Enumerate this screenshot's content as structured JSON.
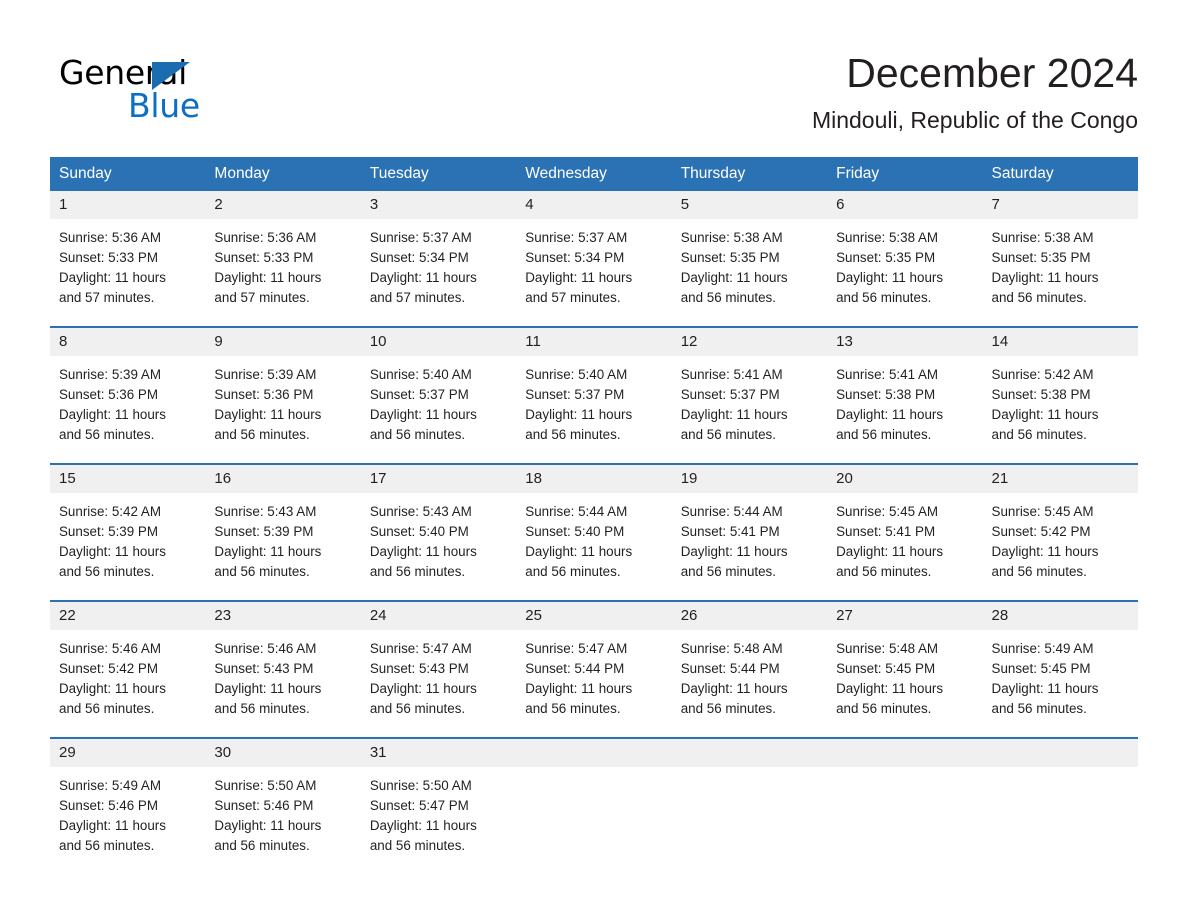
{
  "brand": {
    "name_part1": "General",
    "name_part2": "Blue",
    "accent_color": "#1b6cb0",
    "blue_text_color": "#0b6fc4"
  },
  "header": {
    "month_title": "December 2024",
    "location": "Mindouli, Republic of the Congo"
  },
  "calendar": {
    "header_bg": "#2b72b4",
    "day_number_bg": "#f0f0f0",
    "weekdays": [
      "Sunday",
      "Monday",
      "Tuesday",
      "Wednesday",
      "Thursday",
      "Friday",
      "Saturday"
    ],
    "weeks": [
      [
        {
          "day": "1",
          "sunrise": "Sunrise: 5:36 AM",
          "sunset": "Sunset: 5:33 PM",
          "daylight_line1": "Daylight: 11 hours",
          "daylight_line2": "and 57 minutes."
        },
        {
          "day": "2",
          "sunrise": "Sunrise: 5:36 AM",
          "sunset": "Sunset: 5:33 PM",
          "daylight_line1": "Daylight: 11 hours",
          "daylight_line2": "and 57 minutes."
        },
        {
          "day": "3",
          "sunrise": "Sunrise: 5:37 AM",
          "sunset": "Sunset: 5:34 PM",
          "daylight_line1": "Daylight: 11 hours",
          "daylight_line2": "and 57 minutes."
        },
        {
          "day": "4",
          "sunrise": "Sunrise: 5:37 AM",
          "sunset": "Sunset: 5:34 PM",
          "daylight_line1": "Daylight: 11 hours",
          "daylight_line2": "and 57 minutes."
        },
        {
          "day": "5",
          "sunrise": "Sunrise: 5:38 AM",
          "sunset": "Sunset: 5:35 PM",
          "daylight_line1": "Daylight: 11 hours",
          "daylight_line2": "and 56 minutes."
        },
        {
          "day": "6",
          "sunrise": "Sunrise: 5:38 AM",
          "sunset": "Sunset: 5:35 PM",
          "daylight_line1": "Daylight: 11 hours",
          "daylight_line2": "and 56 minutes."
        },
        {
          "day": "7",
          "sunrise": "Sunrise: 5:38 AM",
          "sunset": "Sunset: 5:35 PM",
          "daylight_line1": "Daylight: 11 hours",
          "daylight_line2": "and 56 minutes."
        }
      ],
      [
        {
          "day": "8",
          "sunrise": "Sunrise: 5:39 AM",
          "sunset": "Sunset: 5:36 PM",
          "daylight_line1": "Daylight: 11 hours",
          "daylight_line2": "and 56 minutes."
        },
        {
          "day": "9",
          "sunrise": "Sunrise: 5:39 AM",
          "sunset": "Sunset: 5:36 PM",
          "daylight_line1": "Daylight: 11 hours",
          "daylight_line2": "and 56 minutes."
        },
        {
          "day": "10",
          "sunrise": "Sunrise: 5:40 AM",
          "sunset": "Sunset: 5:37 PM",
          "daylight_line1": "Daylight: 11 hours",
          "daylight_line2": "and 56 minutes."
        },
        {
          "day": "11",
          "sunrise": "Sunrise: 5:40 AM",
          "sunset": "Sunset: 5:37 PM",
          "daylight_line1": "Daylight: 11 hours",
          "daylight_line2": "and 56 minutes."
        },
        {
          "day": "12",
          "sunrise": "Sunrise: 5:41 AM",
          "sunset": "Sunset: 5:37 PM",
          "daylight_line1": "Daylight: 11 hours",
          "daylight_line2": "and 56 minutes."
        },
        {
          "day": "13",
          "sunrise": "Sunrise: 5:41 AM",
          "sunset": "Sunset: 5:38 PM",
          "daylight_line1": "Daylight: 11 hours",
          "daylight_line2": "and 56 minutes."
        },
        {
          "day": "14",
          "sunrise": "Sunrise: 5:42 AM",
          "sunset": "Sunset: 5:38 PM",
          "daylight_line1": "Daylight: 11 hours",
          "daylight_line2": "and 56 minutes."
        }
      ],
      [
        {
          "day": "15",
          "sunrise": "Sunrise: 5:42 AM",
          "sunset": "Sunset: 5:39 PM",
          "daylight_line1": "Daylight: 11 hours",
          "daylight_line2": "and 56 minutes."
        },
        {
          "day": "16",
          "sunrise": "Sunrise: 5:43 AM",
          "sunset": "Sunset: 5:39 PM",
          "daylight_line1": "Daylight: 11 hours",
          "daylight_line2": "and 56 minutes."
        },
        {
          "day": "17",
          "sunrise": "Sunrise: 5:43 AM",
          "sunset": "Sunset: 5:40 PM",
          "daylight_line1": "Daylight: 11 hours",
          "daylight_line2": "and 56 minutes."
        },
        {
          "day": "18",
          "sunrise": "Sunrise: 5:44 AM",
          "sunset": "Sunset: 5:40 PM",
          "daylight_line1": "Daylight: 11 hours",
          "daylight_line2": "and 56 minutes."
        },
        {
          "day": "19",
          "sunrise": "Sunrise: 5:44 AM",
          "sunset": "Sunset: 5:41 PM",
          "daylight_line1": "Daylight: 11 hours",
          "daylight_line2": "and 56 minutes."
        },
        {
          "day": "20",
          "sunrise": "Sunrise: 5:45 AM",
          "sunset": "Sunset: 5:41 PM",
          "daylight_line1": "Daylight: 11 hours",
          "daylight_line2": "and 56 minutes."
        },
        {
          "day": "21",
          "sunrise": "Sunrise: 5:45 AM",
          "sunset": "Sunset: 5:42 PM",
          "daylight_line1": "Daylight: 11 hours",
          "daylight_line2": "and 56 minutes."
        }
      ],
      [
        {
          "day": "22",
          "sunrise": "Sunrise: 5:46 AM",
          "sunset": "Sunset: 5:42 PM",
          "daylight_line1": "Daylight: 11 hours",
          "daylight_line2": "and 56 minutes."
        },
        {
          "day": "23",
          "sunrise": "Sunrise: 5:46 AM",
          "sunset": "Sunset: 5:43 PM",
          "daylight_line1": "Daylight: 11 hours",
          "daylight_line2": "and 56 minutes."
        },
        {
          "day": "24",
          "sunrise": "Sunrise: 5:47 AM",
          "sunset": "Sunset: 5:43 PM",
          "daylight_line1": "Daylight: 11 hours",
          "daylight_line2": "and 56 minutes."
        },
        {
          "day": "25",
          "sunrise": "Sunrise: 5:47 AM",
          "sunset": "Sunset: 5:44 PM",
          "daylight_line1": "Daylight: 11 hours",
          "daylight_line2": "and 56 minutes."
        },
        {
          "day": "26",
          "sunrise": "Sunrise: 5:48 AM",
          "sunset": "Sunset: 5:44 PM",
          "daylight_line1": "Daylight: 11 hours",
          "daylight_line2": "and 56 minutes."
        },
        {
          "day": "27",
          "sunrise": "Sunrise: 5:48 AM",
          "sunset": "Sunset: 5:45 PM",
          "daylight_line1": "Daylight: 11 hours",
          "daylight_line2": "and 56 minutes."
        },
        {
          "day": "28",
          "sunrise": "Sunrise: 5:49 AM",
          "sunset": "Sunset: 5:45 PM",
          "daylight_line1": "Daylight: 11 hours",
          "daylight_line2": "and 56 minutes."
        }
      ],
      [
        {
          "day": "29",
          "sunrise": "Sunrise: 5:49 AM",
          "sunset": "Sunset: 5:46 PM",
          "daylight_line1": "Daylight: 11 hours",
          "daylight_line2": "and 56 minutes."
        },
        {
          "day": "30",
          "sunrise": "Sunrise: 5:50 AM",
          "sunset": "Sunset: 5:46 PM",
          "daylight_line1": "Daylight: 11 hours",
          "daylight_line2": "and 56 minutes."
        },
        {
          "day": "31",
          "sunrise": "Sunrise: 5:50 AM",
          "sunset": "Sunset: 5:47 PM",
          "daylight_line1": "Daylight: 11 hours",
          "daylight_line2": "and 56 minutes."
        },
        {
          "day": "",
          "sunrise": "",
          "sunset": "",
          "daylight_line1": "",
          "daylight_line2": "",
          "empty": true
        },
        {
          "day": "",
          "sunrise": "",
          "sunset": "",
          "daylight_line1": "",
          "daylight_line2": "",
          "empty": true
        },
        {
          "day": "",
          "sunrise": "",
          "sunset": "",
          "daylight_line1": "",
          "daylight_line2": "",
          "empty": true
        },
        {
          "day": "",
          "sunrise": "",
          "sunset": "",
          "daylight_line1": "",
          "daylight_line2": "",
          "empty": true
        }
      ]
    ]
  }
}
